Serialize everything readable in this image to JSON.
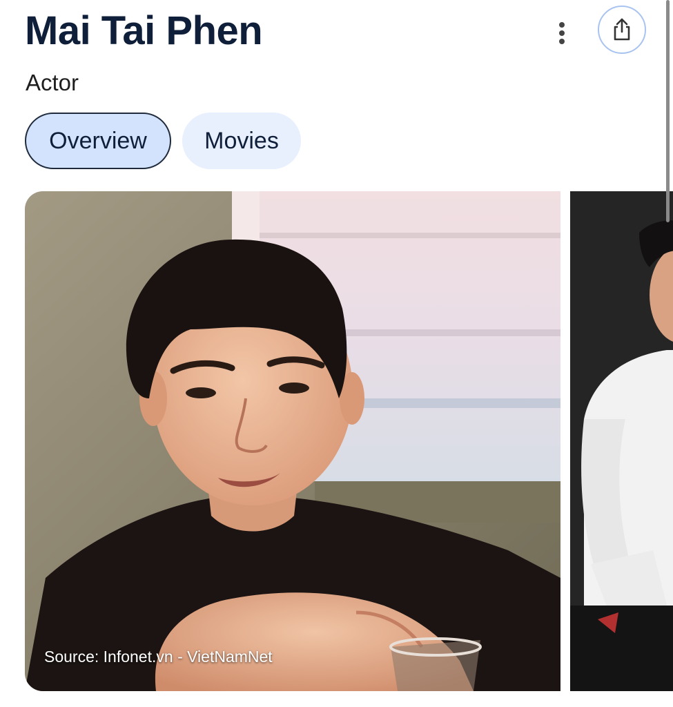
{
  "header": {
    "title": "Mai Tai Phen",
    "subtitle": "Actor"
  },
  "toolbar": {
    "more_icon": "more-vertical-icon",
    "share_icon": "share-icon"
  },
  "tabs": [
    {
      "label": "Overview",
      "selected": true
    },
    {
      "label": "Movies",
      "selected": false
    }
  ],
  "images": {
    "main": {
      "source": "Source: Infonet.vn - VietNamNet"
    }
  },
  "colors": {
    "title_text": "#0f1f3a",
    "tab_selected_bg": "#d3e3fd",
    "tab_bg": "#e8effd",
    "share_border": "#a8c3f0"
  }
}
